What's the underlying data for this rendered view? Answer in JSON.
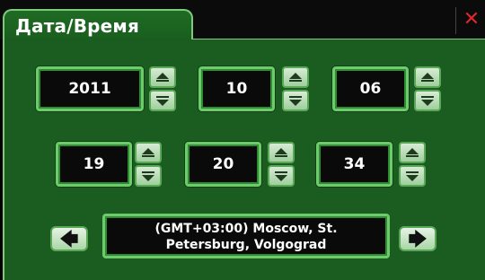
{
  "window": {
    "title": "Дата/Время",
    "close_icon": "✕"
  },
  "date": {
    "year": "2011",
    "month": "10",
    "day": "06"
  },
  "time": {
    "hour": "19",
    "minute": "20",
    "second": "34"
  },
  "timezone": {
    "line1": "(GMT+03:00) Moscow, St.",
    "line2": "Petersburg, Volgograd"
  },
  "nav": {
    "prev_icon": "🡄",
    "next_icon": "🡆"
  },
  "colors": {
    "panel": "#1b5c20",
    "border": "#6ecb6c",
    "close": "#e0262b"
  }
}
